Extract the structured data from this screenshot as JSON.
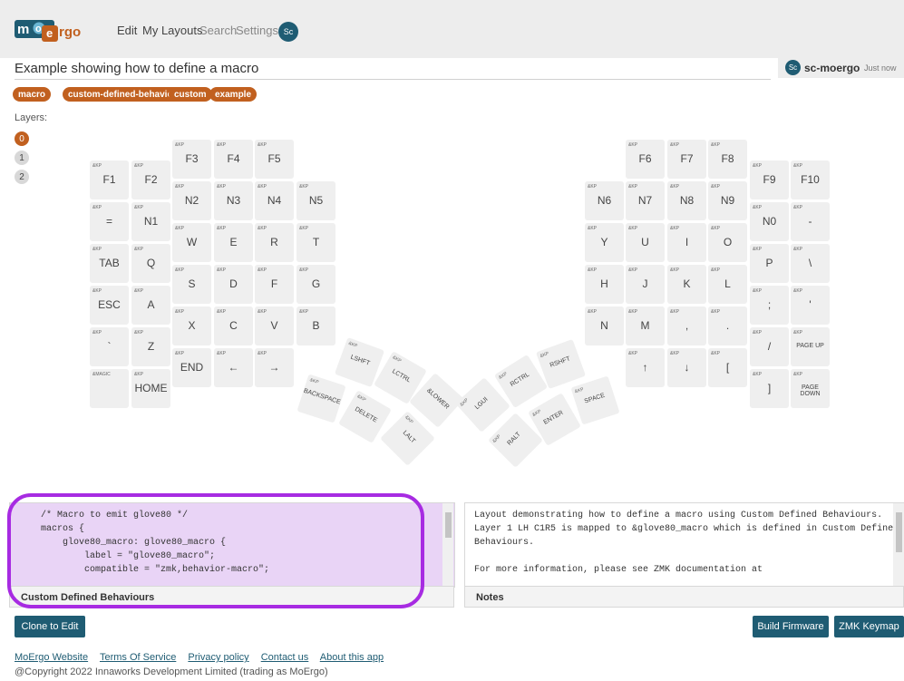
{
  "brand": {
    "logo_text": "moergo"
  },
  "nav": {
    "items": [
      "Edit",
      "My Layouts",
      "Search",
      "Settings"
    ],
    "avatar": "Sc"
  },
  "layout": {
    "title": "Example showing how to define a macro",
    "user_avatar": "Sc",
    "user_name": "sc-moergo",
    "timestamp": "Just now"
  },
  "tags": [
    "macro",
    "custom-defined-behaviours",
    "custom",
    "example"
  ],
  "layers": {
    "label": "Layers:",
    "items": [
      "0",
      "1",
      "2"
    ],
    "active": "0"
  },
  "keys": [
    {
      "id": "F1",
      "bh": "&KP",
      "label": "F1"
    },
    {
      "id": "F2",
      "bh": "&KP",
      "label": "F2"
    },
    {
      "id": "F3",
      "bh": "&KP",
      "label": "F3"
    },
    {
      "id": "F4",
      "bh": "&KP",
      "label": "F4"
    },
    {
      "id": "F5",
      "bh": "&KP",
      "label": "F5"
    },
    {
      "id": "EQ",
      "bh": "&KP",
      "label": "="
    },
    {
      "id": "N1",
      "bh": "&KP",
      "label": "N1"
    },
    {
      "id": "N2",
      "bh": "&KP",
      "label": "N2"
    },
    {
      "id": "N3",
      "bh": "&KP",
      "label": "N3"
    },
    {
      "id": "N4",
      "bh": "&KP",
      "label": "N4"
    },
    {
      "id": "N5",
      "bh": "&KP",
      "label": "N5"
    },
    {
      "id": "TAB",
      "bh": "&KP",
      "label": "TAB"
    },
    {
      "id": "Q",
      "bh": "&KP",
      "label": "Q"
    },
    {
      "id": "W",
      "bh": "&KP",
      "label": "W"
    },
    {
      "id": "E",
      "bh": "&KP",
      "label": "E"
    },
    {
      "id": "R",
      "bh": "&KP",
      "label": "R"
    },
    {
      "id": "T",
      "bh": "&KP",
      "label": "T"
    },
    {
      "id": "ESC",
      "bh": "&KP",
      "label": "ESC"
    },
    {
      "id": "A",
      "bh": "&KP",
      "label": "A"
    },
    {
      "id": "S",
      "bh": "&KP",
      "label": "S"
    },
    {
      "id": "D",
      "bh": "&KP",
      "label": "D"
    },
    {
      "id": "F",
      "bh": "&KP",
      "label": "F"
    },
    {
      "id": "G",
      "bh": "&KP",
      "label": "G"
    },
    {
      "id": "GRAVE",
      "bh": "&KP",
      "label": "`"
    },
    {
      "id": "Z",
      "bh": "&KP",
      "label": "Z"
    },
    {
      "id": "X",
      "bh": "&KP",
      "label": "X"
    },
    {
      "id": "C",
      "bh": "&KP",
      "label": "C"
    },
    {
      "id": "V",
      "bh": "&KP",
      "label": "V"
    },
    {
      "id": "B",
      "bh": "&KP",
      "label": "B"
    },
    {
      "id": "MAGIC",
      "bh": "&MAGIC",
      "label": ""
    },
    {
      "id": "HOME",
      "bh": "&KP",
      "label": "HOME"
    },
    {
      "id": "END",
      "bh": "&KP",
      "label": "END"
    },
    {
      "id": "LEFT",
      "bh": "&KP",
      "label": "←"
    },
    {
      "id": "RIGHT",
      "bh": "&KP",
      "label": "→"
    },
    {
      "id": "F6",
      "bh": "&KP",
      "label": "F6"
    },
    {
      "id": "F7",
      "bh": "&KP",
      "label": "F7"
    },
    {
      "id": "F8",
      "bh": "&KP",
      "label": "F8"
    },
    {
      "id": "F9",
      "bh": "&KP",
      "label": "F9"
    },
    {
      "id": "F10",
      "bh": "&KP",
      "label": "F10"
    },
    {
      "id": "N6",
      "bh": "&KP",
      "label": "N6"
    },
    {
      "id": "N7",
      "bh": "&KP",
      "label": "N7"
    },
    {
      "id": "N8",
      "bh": "&KP",
      "label": "N8"
    },
    {
      "id": "N9",
      "bh": "&KP",
      "label": "N9"
    },
    {
      "id": "N0",
      "bh": "&KP",
      "label": "N0"
    },
    {
      "id": "MINUS",
      "bh": "&KP",
      "label": "-"
    },
    {
      "id": "Y",
      "bh": "&KP",
      "label": "Y"
    },
    {
      "id": "U",
      "bh": "&KP",
      "label": "U"
    },
    {
      "id": "I",
      "bh": "&KP",
      "label": "I"
    },
    {
      "id": "O",
      "bh": "&KP",
      "label": "O"
    },
    {
      "id": "P",
      "bh": "&KP",
      "label": "P"
    },
    {
      "id": "BSLASH",
      "bh": "&KP",
      "label": "\\"
    },
    {
      "id": "H",
      "bh": "&KP",
      "label": "H"
    },
    {
      "id": "J",
      "bh": "&KP",
      "label": "J"
    },
    {
      "id": "K",
      "bh": "&KP",
      "label": "K"
    },
    {
      "id": "L",
      "bh": "&KP",
      "label": "L"
    },
    {
      "id": "SEMI",
      "bh": "&KP",
      "label": ";"
    },
    {
      "id": "QUOTE",
      "bh": "&KP",
      "label": "'"
    },
    {
      "id": "N",
      "bh": "&KP",
      "label": "N"
    },
    {
      "id": "M",
      "bh": "&KP",
      "label": "M"
    },
    {
      "id": "COMMA",
      "bh": "&KP",
      "label": ","
    },
    {
      "id": "DOT",
      "bh": "&KP",
      "label": "."
    },
    {
      "id": "SLASH",
      "bh": "&KP",
      "label": "/"
    },
    {
      "id": "PGUP",
      "bh": "&KP",
      "label": "PAGE UP"
    },
    {
      "id": "UP",
      "bh": "&KP",
      "label": "↑"
    },
    {
      "id": "DOWN",
      "bh": "&KP",
      "label": "↓"
    },
    {
      "id": "LBKT",
      "bh": "&KP",
      "label": "["
    },
    {
      "id": "RBKT",
      "bh": "&KP",
      "label": "]"
    },
    {
      "id": "PGDN",
      "bh": "&KP",
      "label": "PAGE DOWN"
    },
    {
      "id": "LSHFT",
      "bh": "&KP",
      "label": "LSHFT"
    },
    {
      "id": "LCTRL",
      "bh": "&KP",
      "label": "LCTRL"
    },
    {
      "id": "LOWER",
      "bh": "",
      "label": "&LOWER"
    },
    {
      "id": "BKSP",
      "bh": "&KP",
      "label": "BACKSPACE"
    },
    {
      "id": "DEL",
      "bh": "&KP",
      "label": "DELETE"
    },
    {
      "id": "LALT",
      "bh": "&KP",
      "label": "LALT"
    },
    {
      "id": "RSHFT",
      "bh": "&KP",
      "label": "RSHFT"
    },
    {
      "id": "RCTRL",
      "bh": "&KP",
      "label": "RCTRL"
    },
    {
      "id": "LGUI",
      "bh": "&KP",
      "label": "LGUI"
    },
    {
      "id": "SPACE",
      "bh": "&KP",
      "label": "SPACE"
    },
    {
      "id": "ENTER",
      "bh": "&KP",
      "label": "ENTER"
    },
    {
      "id": "RALT",
      "bh": "&KP",
      "label": "RALT"
    }
  ],
  "custom_behaviours": {
    "code": "    /* Macro to emit glove80 */\n    macros {\n        glove80_macro: glove80_macro {\n            label = \"glove80_macro\";\n            compatible = \"zmk,behavior-macro\";",
    "title": "Custom Defined Behaviours"
  },
  "notes": {
    "text": "Layout demonstrating how to define a macro using Custom Defined Behaviours.\nLayer 1 LH C1R5 is mapped to &glove80_macro which is defined in Custom Defined\nBehaviours.\n\nFor more information, please see ZMK documentation at",
    "title": "Notes"
  },
  "buttons": {
    "clone": "Clone to Edit",
    "build": "Build Firmware",
    "keymap": "ZMK Keymap"
  },
  "footer": {
    "links": [
      "MoErgo Website",
      "Terms Of Service",
      "Privacy policy",
      "Contact us",
      "About this app"
    ],
    "copyright": "@Copyright 2022 Innaworks Development Limited (trading as MoErgo)"
  },
  "colors": {
    "accent": "#c1601f",
    "primary": "#1f5c73",
    "highlight": "#a72be2"
  }
}
